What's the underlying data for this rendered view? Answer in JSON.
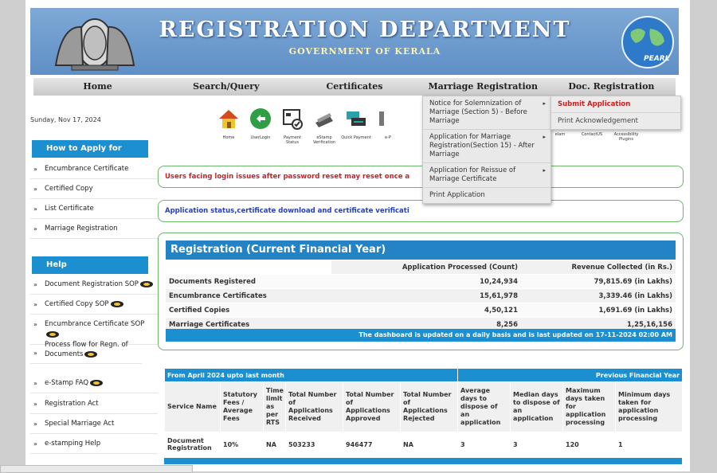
{
  "banner": {
    "title": "REGISTRATION DEPARTMENT",
    "subtitle": "GOVERNMENT OF KERALA",
    "globe_text": "PEARL",
    "colors": {
      "banner": "#6f9ccf",
      "title": "#ffffff",
      "subtitle": "#fff3b0"
    }
  },
  "nav": [
    "Home",
    "Search/Query",
    "Certificates",
    "Marriage Registration",
    "Doc. Registration"
  ],
  "date": "Sunday, Nov 17, 2024",
  "icons": [
    {
      "label": "Home",
      "icon": "house-icon"
    },
    {
      "label": "UserLogin",
      "icon": "user-login-icon"
    },
    {
      "label": "Payment Status",
      "icon": "payment-status-icon"
    },
    {
      "label": "eStamp Verification",
      "icon": "estamp-icon"
    },
    {
      "label": "Quick Payment",
      "icon": "quick-payment-icon"
    },
    {
      "label": "e-P",
      "icon": "epay-icon"
    }
  ],
  "icons_right": [
    "elam",
    "ContactUS",
    "Accessibility Plugins"
  ],
  "sidebar": {
    "apply_heading": "How to Apply for",
    "apply_items": [
      "Encumbrance Certificate",
      "Certified Copy",
      "List Certificate",
      "Marriage Registration"
    ],
    "help_heading": "Help",
    "help_items": [
      {
        "label": "Document Registration SOP",
        "badge": true
      },
      {
        "label": "Certified Copy SOP",
        "badge": true
      },
      {
        "label": "Encumbrance Certificate SOP",
        "badge": true
      },
      {
        "label": "Process flow for Regn. of Documents",
        "badge": true
      },
      {
        "label": "e-Stamp FAQ",
        "badge": true
      },
      {
        "label": "Registration Act",
        "badge": false
      },
      {
        "label": "Special Marriage Act",
        "badge": false
      },
      {
        "label": "e-stamping Help",
        "badge": false
      }
    ]
  },
  "notices": [
    {
      "text": "Users facing login issues after password reset may reset once a",
      "color": "#c0262d"
    },
    {
      "text": "Application status,certificate download and certificate verificati",
      "color": "#2a3fb0"
    }
  ],
  "registration": {
    "title": "Registration (Current Financial Year)",
    "col_count": "Application Processed (Count)",
    "col_revenue": "Revenue Collected (in Rs.)",
    "rows": [
      {
        "name": "Documents Registered",
        "count": "10,24,934",
        "revenue": "79,815.69 (in Lakhs)"
      },
      {
        "name": "Encumbrance Certificates",
        "count": "15,61,978",
        "revenue": "3,339.46 (in Lakhs)"
      },
      {
        "name": "Certified Copies",
        "count": "4,50,121",
        "revenue": "1,691.69 (in Lakhs)"
      },
      {
        "name": "Marriage Certificates",
        "count": "8,256",
        "revenue": "1,25,16,156"
      }
    ],
    "updated_note": "The dashboard is updated on a daily basis and is last updated on 17-11-2024 02:00 AM"
  },
  "stats": {
    "band_left": "From April 2024 upto last month",
    "band_right": "Previous Financial Year",
    "headers": [
      "Service Name",
      "Statutory Fees / Average Fees",
      "Time limit as per RTS",
      "Total Number of Applications Received",
      "Total Number of Applications Approved",
      "Total Number of Applications Rejected",
      "Average days to dispose of an application",
      "Median days to dispose of an application",
      "Maximum days taken for application processing",
      "Minimum days taken for application processing"
    ],
    "rows": [
      [
        "Document Registration",
        "10%",
        "NA",
        "503233",
        "946477",
        "NA",
        "3",
        "3",
        "120",
        "1"
      ]
    ]
  },
  "marriage_menu": {
    "items": [
      {
        "label": "Notice for Solemnization of Marriage (Section 5) - Before Marriage",
        "has_sub": true
      },
      {
        "label": "Application for Marriage Registration(Section 15) - After Marriage",
        "has_sub": true
      },
      {
        "label": "Application for Reissue of Marriage Certificate",
        "has_sub": true
      },
      {
        "label": "Print Application",
        "has_sub": false
      }
    ],
    "submenu": [
      "Submit Application",
      "Print Acknowledgement"
    ]
  }
}
